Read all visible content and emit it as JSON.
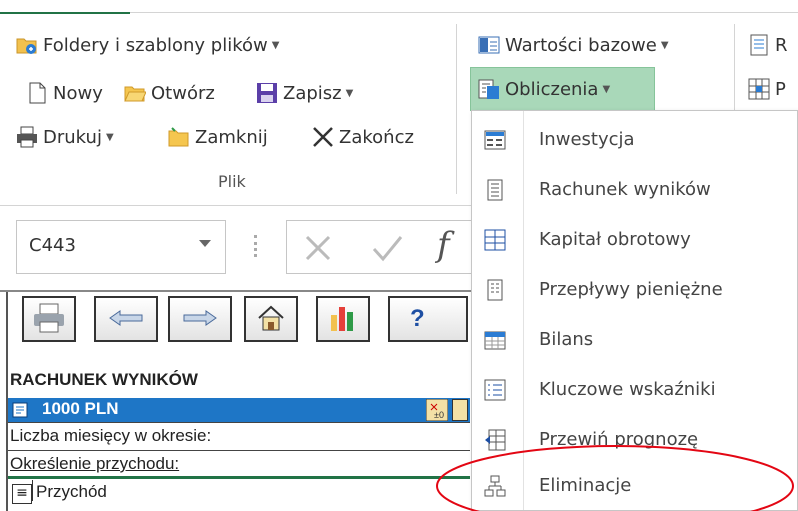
{
  "ribbon": {
    "file_group": {
      "folders_label": "Foldery i szablony plików",
      "new_label": "Nowy",
      "open_label": "Otwórz",
      "save_label": "Zapisz",
      "print_label": "Drukuj",
      "close_label": "Zamknij",
      "exit_label": "Zakończ",
      "group_label": "Plik"
    },
    "values_group": {
      "base_values_label": "Wartości bazowe",
      "calculations_label": "Obliczenia",
      "cut_r": "R",
      "cut_p": "P"
    }
  },
  "formula_bar": {
    "name_box": "C443",
    "fx": "f"
  },
  "sheet": {
    "toolbar_help": "?",
    "title": "RACHUNEK WYNIKÓW",
    "unit_row": "1000 PLN",
    "row1": "Liczba miesięcy w okresie:",
    "row2": "Określenie przychodu:",
    "row3": "Przychód",
    "row3_icon": "≡"
  },
  "menu": {
    "items": [
      {
        "label": "Inwestycja",
        "icon": "investment-icon"
      },
      {
        "label": "Rachunek wyników",
        "icon": "income-statement-icon"
      },
      {
        "label": "Kapitał obrotowy",
        "icon": "working-capital-icon"
      },
      {
        "label": "Przepływy pieniężne",
        "icon": "cash-flow-icon"
      },
      {
        "label": "Bilans",
        "icon": "balance-sheet-icon"
      },
      {
        "label": "Kluczowe wskaźniki",
        "icon": "key-indicators-icon"
      },
      {
        "label": "Przewiń prognozę",
        "icon": "scroll-forecast-icon"
      },
      {
        "label": "Eliminacje",
        "icon": "eliminations-icon"
      }
    ]
  },
  "colors": {
    "accent_green": "#217346",
    "active_button": "#a9d8b9",
    "sheet_header_blue": "#1e76c6",
    "highlight_ellipse": "#e30613"
  }
}
